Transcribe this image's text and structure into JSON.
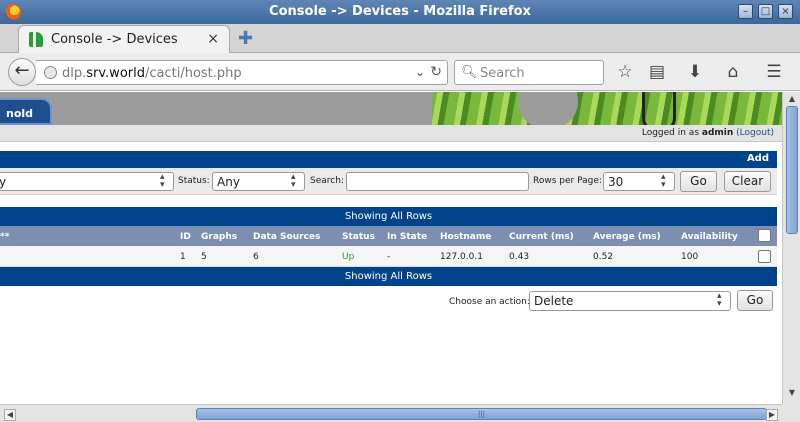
{
  "window": {
    "title": "Console -> Devices - Mozilla Firefox"
  },
  "tab": {
    "label": "Console -> Devices",
    "close": "×",
    "new_tab": "✚"
  },
  "nav": {
    "back_glyph": "←",
    "url_prefix": "dlp.",
    "url_host": "srv.world",
    "url_path": "/cacti/host.php",
    "search_placeholder": "Search",
    "icons": [
      "star-icon",
      "clipboard-icon",
      "download-icon",
      "home-icon",
      "menu-icon"
    ]
  },
  "banner": {
    "tab_label": "nold"
  },
  "login": {
    "prefix": "Logged in as",
    "user": "admin",
    "logout": "(Logout)"
  },
  "toolbar": {
    "add_label": "Add"
  },
  "filter": {
    "template_value": "y",
    "status_label": "Status:",
    "status_value": "Any",
    "search_label": "Search:",
    "search_value": "",
    "rows_label": "Rows per Page:",
    "rows_value": "30",
    "go_label": "Go",
    "clear_label": "Clear"
  },
  "table": {
    "showing_top": "Showing All Rows",
    "showing_bottom": "Showing All Rows",
    "headers": {
      "desc": "**",
      "id": "ID",
      "graphs": "Graphs",
      "data_sources": "Data Sources",
      "status": "Status",
      "in_state": "In State",
      "hostname": "Hostname",
      "current": "Current (ms)",
      "average": "Average (ms)",
      "availability": "Availability"
    },
    "rows": [
      {
        "id": "1",
        "graphs": "5",
        "data_sources": "6",
        "status": "Up",
        "in_state": "-",
        "hostname": "127.0.0.1",
        "current": "0.43",
        "average": "0.52",
        "availability": "100"
      }
    ]
  },
  "actions": {
    "label": "Choose an action:",
    "selected": "Delete",
    "go_label": "Go"
  },
  "colors": {
    "navy": "#00438a",
    "header": "#7d8fb0",
    "status_up": "#2a9a3a"
  }
}
